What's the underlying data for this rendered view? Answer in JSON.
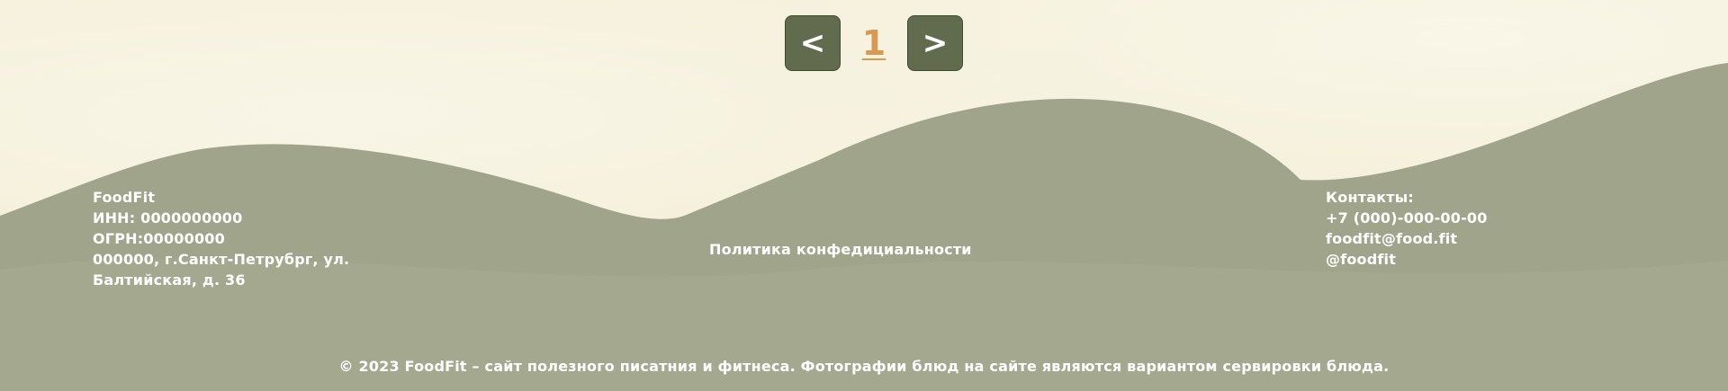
{
  "pagination": {
    "prev_label": "<",
    "current_page": "1",
    "next_label": ">"
  },
  "footer": {
    "company_lines": [
      "FoodFit",
      "ИНН: 0000000000",
      "ОГРН:00000000",
      "000000, г.Санкт-Петрубрг, ул.",
      "Балтийская, д. 36"
    ],
    "policy_link": "Политика конфедициальности",
    "contacts_title": "Контакты:",
    "contacts_phone": "+7 (000)-000-00-00",
    "contacts_email": "foodfit@food.fit",
    "contacts_social": "@foodfit",
    "copyright": "© 2023 FoodFit – сайт полезного писатния и фитнеса. Фотографии блюд на сайте являются вариантом сервировки блюда."
  },
  "colors": {
    "background": "#f5f0d8",
    "wave": "#a0a48a",
    "button": "#616c4f",
    "page_number": "#d89a52",
    "text": "#ffffff"
  }
}
